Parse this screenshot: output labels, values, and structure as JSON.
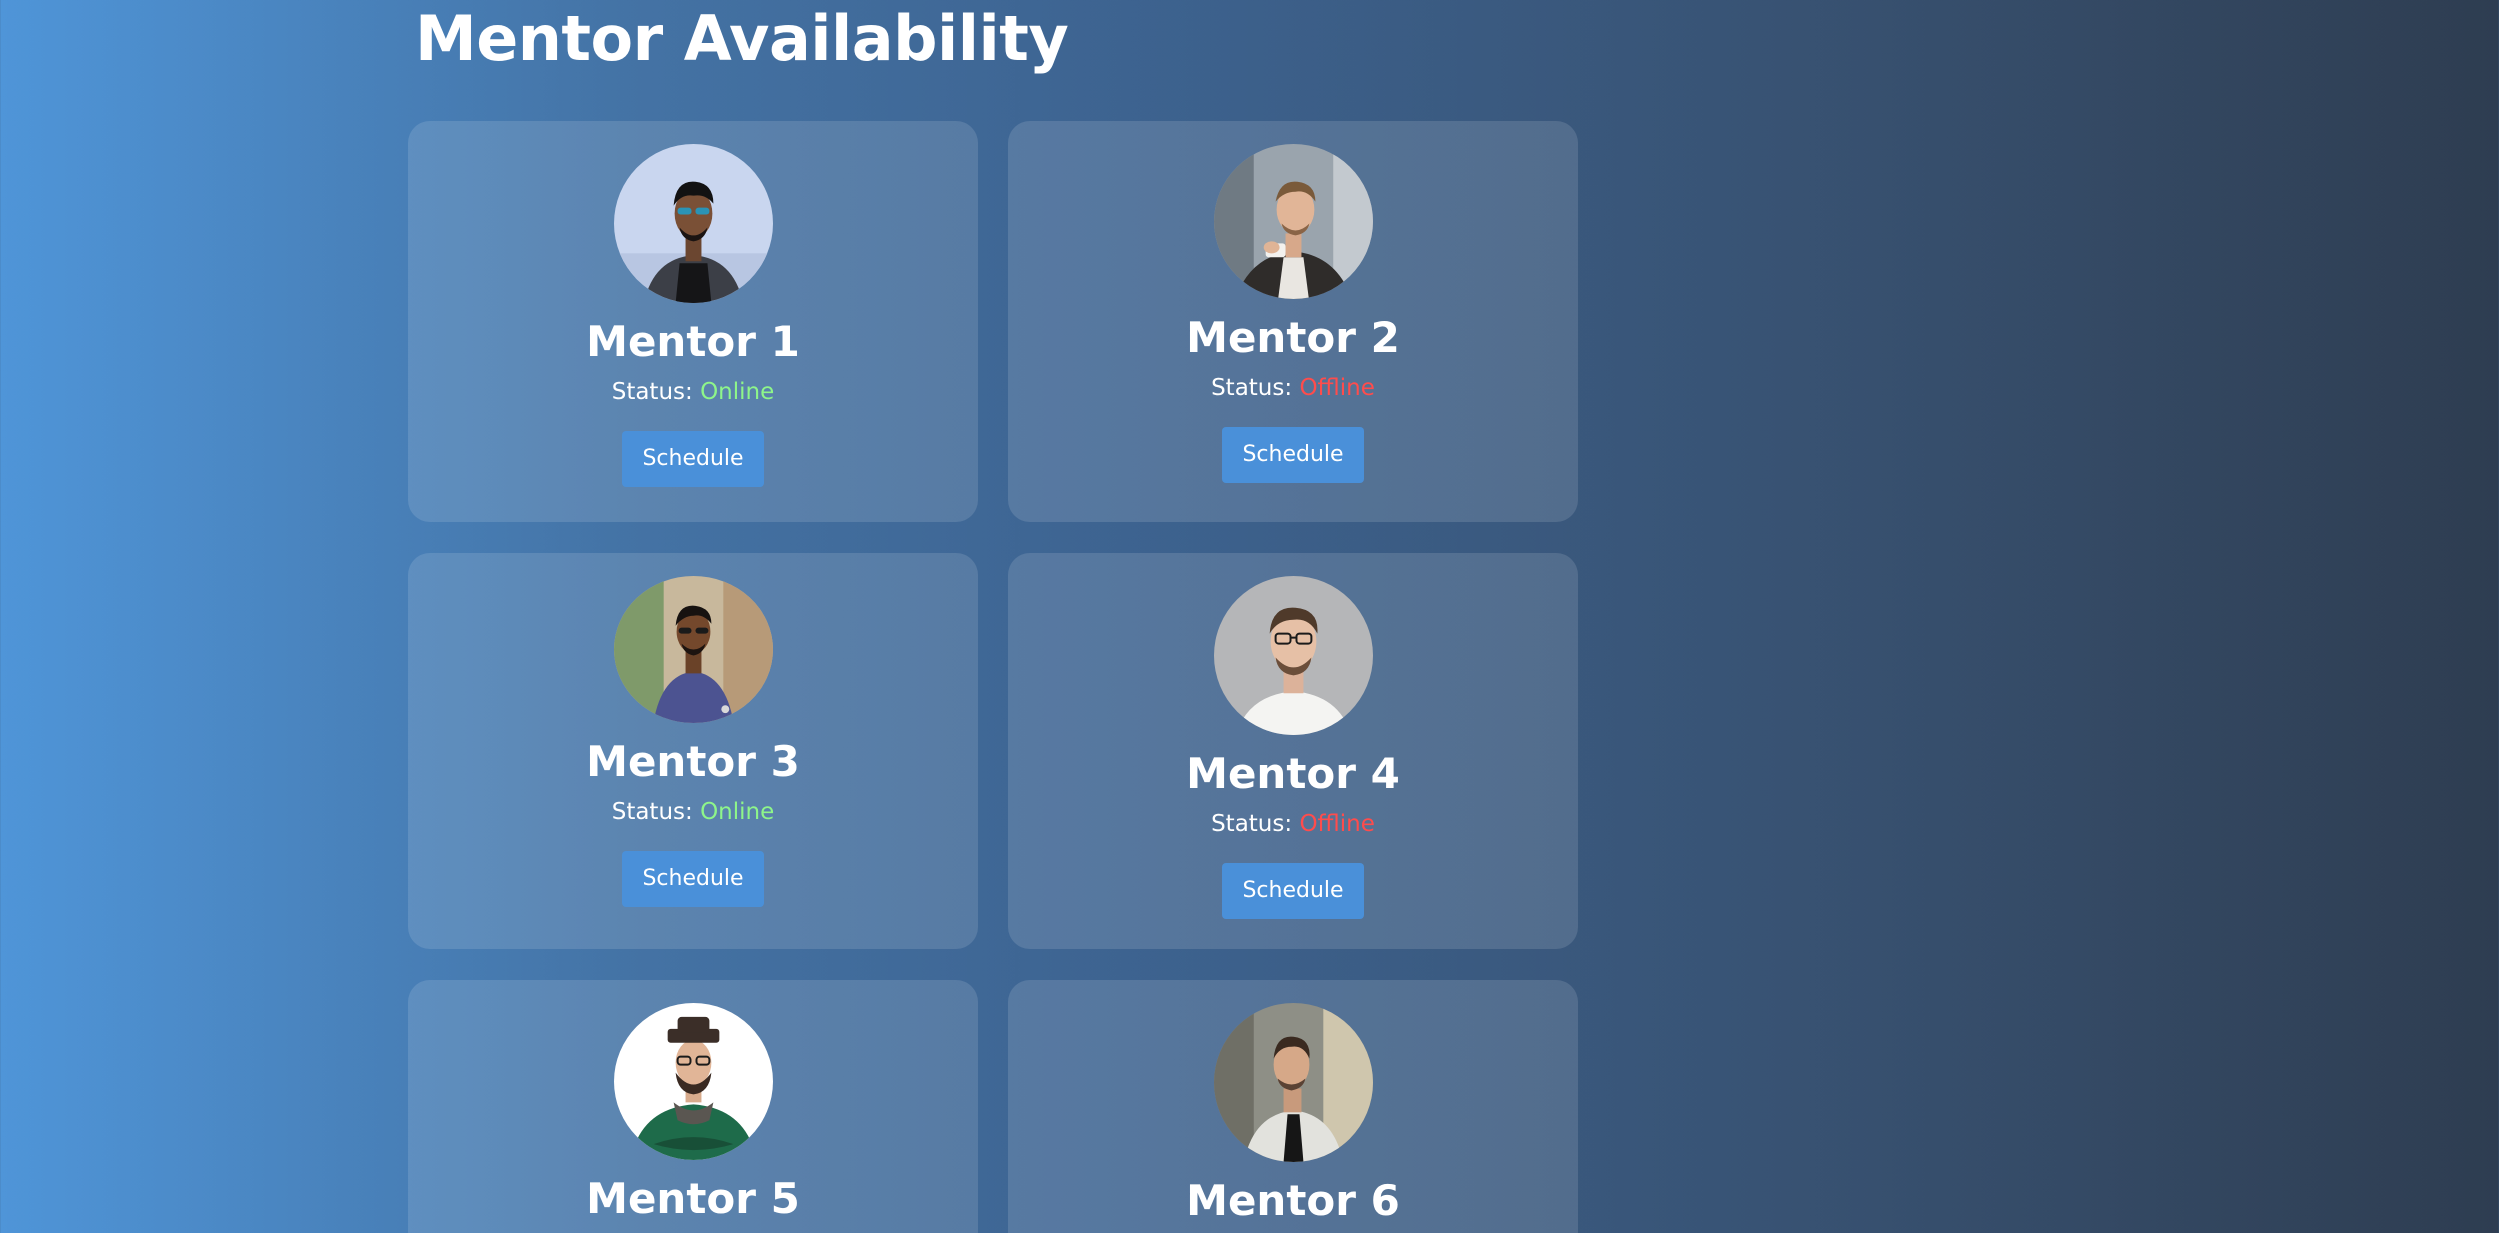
{
  "page": {
    "title": "Mentor Availability"
  },
  "colors": {
    "online": "#8ef58a",
    "offline": "#ff4c4c",
    "button": "#4a90d9"
  },
  "mentors": [
    {
      "name": "Mentor 1",
      "status_label": "Status:",
      "status": "Online",
      "button_label": "Schedule",
      "avatar": "mentor-1-photo"
    },
    {
      "name": "Mentor 2",
      "status_label": "Status:",
      "status": "Offline",
      "button_label": "Schedule",
      "avatar": "mentor-2-photo"
    },
    {
      "name": "Mentor 3",
      "status_label": "Status:",
      "status": "Online",
      "button_label": "Schedule",
      "avatar": "mentor-3-photo"
    },
    {
      "name": "Mentor 4",
      "status_label": "Status:",
      "status": "Offline",
      "button_label": "Schedule",
      "avatar": "mentor-4-photo"
    },
    {
      "name": "Mentor 5",
      "avatar": "mentor-5-photo"
    },
    {
      "name": "Mentor 6",
      "avatar": "mentor-6-photo"
    }
  ]
}
